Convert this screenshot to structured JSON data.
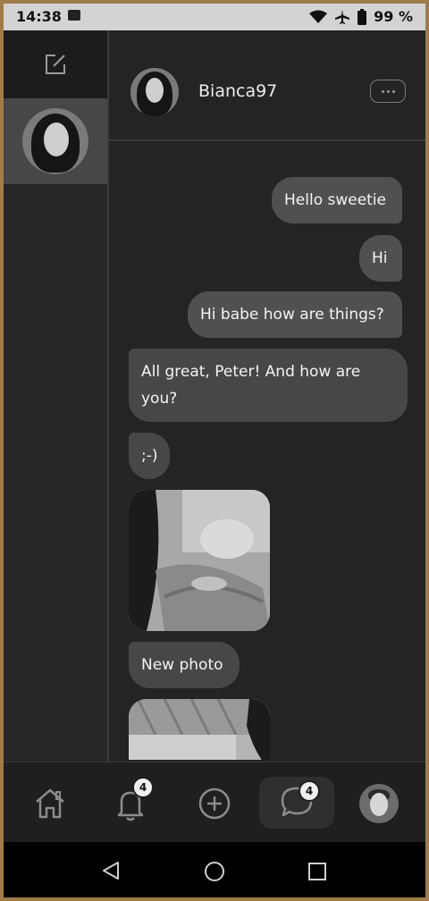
{
  "status_bar": {
    "time": "14:38",
    "battery": "99 %",
    "icons": [
      "image-icon",
      "wifi-icon",
      "airplane-icon",
      "battery-icon"
    ]
  },
  "sidebar": {
    "compose_icon": "compose-icon",
    "conversations": [
      {
        "name": "Bianca97",
        "active": true
      }
    ]
  },
  "chat": {
    "header_name": "Bianca97",
    "more_icon": "more-icon",
    "messages": [
      {
        "dir": "out",
        "text": "Hello sweetie"
      },
      {
        "dir": "out",
        "text": "Hi"
      },
      {
        "dir": "out",
        "text": "Hi babe how are things?"
      },
      {
        "dir": "in",
        "text": "All great, Peter! And how are you?"
      },
      {
        "dir": "in",
        "text": ";-)"
      },
      {
        "dir": "in",
        "type": "photo"
      },
      {
        "dir": "in",
        "text": "New photo"
      },
      {
        "dir": "in",
        "type": "photo"
      }
    ]
  },
  "bottom_nav": {
    "items": [
      {
        "name": "home",
        "icon": "home-icon"
      },
      {
        "name": "notifications",
        "icon": "bell-icon",
        "badge": "4"
      },
      {
        "name": "create",
        "icon": "plus-circle-icon"
      },
      {
        "name": "messages",
        "icon": "chat-icon",
        "badge": "4",
        "active": true
      },
      {
        "name": "profile",
        "icon": "avatar"
      }
    ]
  },
  "system_nav": [
    "back-icon",
    "home-circle-icon",
    "recents-icon"
  ],
  "colors": {
    "background": "#242424",
    "bubble": "#505050",
    "accent_frame": "#a07c4a"
  }
}
